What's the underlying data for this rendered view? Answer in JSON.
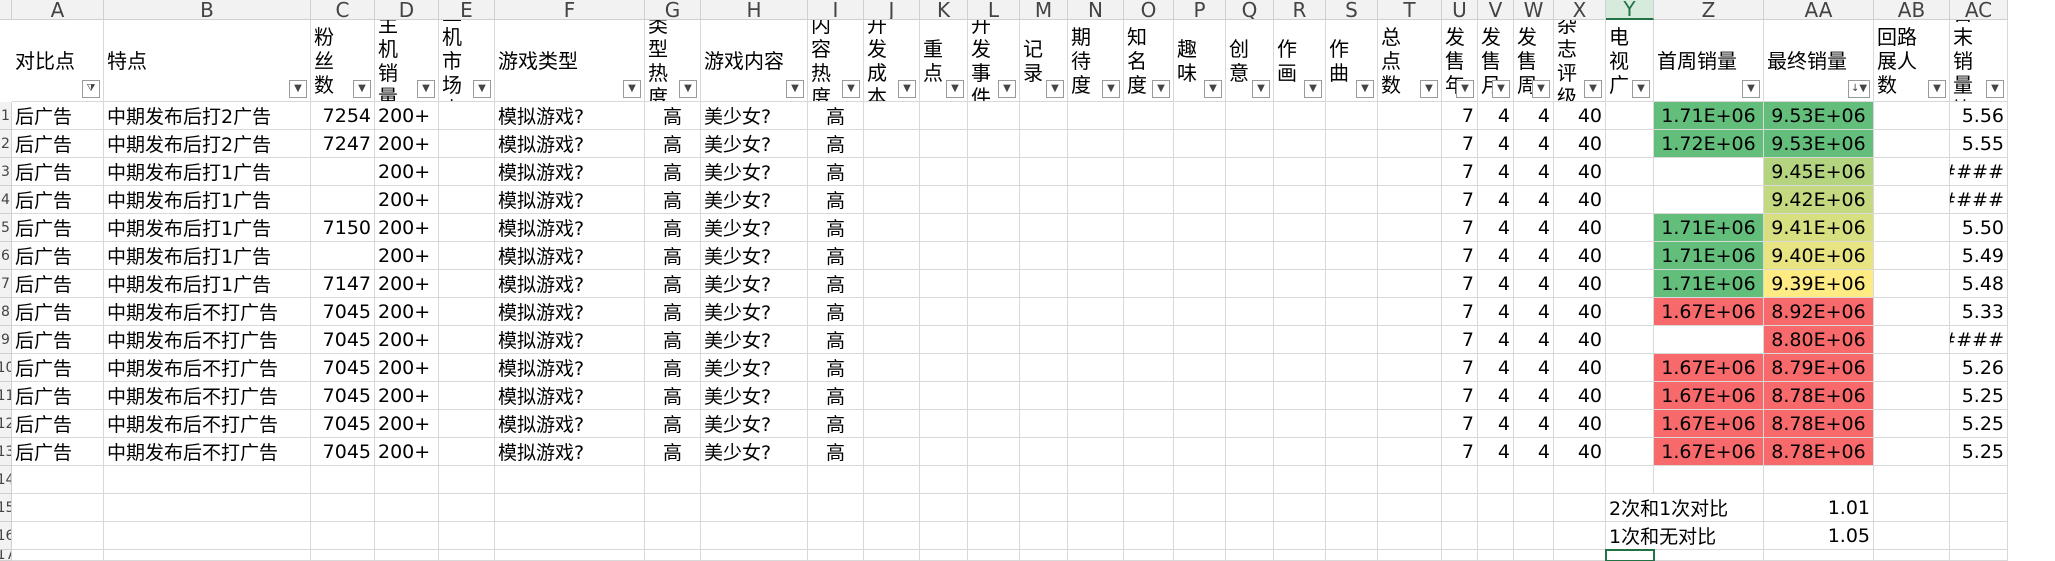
{
  "columns": [
    "A",
    "B",
    "C",
    "D",
    "E",
    "F",
    "G",
    "H",
    "I",
    "J",
    "K",
    "L",
    "M",
    "N",
    "O",
    "P",
    "Q",
    "R",
    "S",
    "T",
    "U",
    "V",
    "W",
    "X",
    "Y",
    "Z",
    "AA",
    "AB",
    "AC"
  ],
  "selected_column": "Y",
  "headers": [
    "对比点",
    "特点",
    "粉丝数",
    "主机销量",
    "主机市场占",
    "游戏类型",
    "类型热度",
    "游戏内容",
    "内容热度",
    "开发成本",
    "重点",
    "开发事件",
    "记录",
    "期待度",
    "知名度",
    "趣味",
    "创意",
    "作画",
    "作曲",
    "总点数",
    "发售年",
    "发售月",
    "发售周",
    "杂志评级",
    "电视广",
    "首周销量",
    "最终销量",
    "回路展人数",
    "首末销量比"
  ],
  "filtered_columns": [
    "A"
  ],
  "sorted_column": "AA",
  "rows": [
    {
      "num": "1",
      "A": "后广告",
      "B": "中期发布后打2广告",
      "C": "7254",
      "D": "200+",
      "F": "模拟游戏?",
      "G": "高",
      "H": "美少女?",
      "I": "高",
      "U": "7",
      "V": "4",
      "W": "4",
      "X": "40",
      "Z": "1.71E+06",
      "AA": "9.53E+06",
      "AC": "5.56"
    },
    {
      "num": "2",
      "A": "后广告",
      "B": "中期发布后打2广告",
      "C": "7247",
      "D": "200+",
      "F": "模拟游戏?",
      "G": "高",
      "H": "美少女?",
      "I": "高",
      "U": "7",
      "V": "4",
      "W": "4",
      "X": "40",
      "Z": "1.72E+06",
      "AA": "9.53E+06",
      "AC": "5.55"
    },
    {
      "num": "3",
      "A": "后广告",
      "B": "中期发布后打1广告",
      "C": "",
      "D": "200+",
      "F": "模拟游戏?",
      "G": "高",
      "H": "美少女?",
      "I": "高",
      "U": "7",
      "V": "4",
      "W": "4",
      "X": "40",
      "Z": "",
      "AA": "9.45E+06",
      "AC": "####"
    },
    {
      "num": "4",
      "A": "后广告",
      "B": "中期发布后打1广告",
      "C": "",
      "D": "200+",
      "F": "模拟游戏?",
      "G": "高",
      "H": "美少女?",
      "I": "高",
      "U": "7",
      "V": "4",
      "W": "4",
      "X": "40",
      "Z": "",
      "AA": "9.42E+06",
      "AC": "####"
    },
    {
      "num": "5",
      "A": "后广告",
      "B": "中期发布后打1广告",
      "C": "7150",
      "D": "200+",
      "F": "模拟游戏?",
      "G": "高",
      "H": "美少女?",
      "I": "高",
      "U": "7",
      "V": "4",
      "W": "4",
      "X": "40",
      "Z": "1.71E+06",
      "AA": "9.41E+06",
      "AC": "5.50"
    },
    {
      "num": "6",
      "A": "后广告",
      "B": "中期发布后打1广告",
      "C": "",
      "D": "200+",
      "F": "模拟游戏?",
      "G": "高",
      "H": "美少女?",
      "I": "高",
      "U": "7",
      "V": "4",
      "W": "4",
      "X": "40",
      "Z": "1.71E+06",
      "AA": "9.40E+06",
      "AC": "5.49"
    },
    {
      "num": "7",
      "A": "后广告",
      "B": "中期发布后打1广告",
      "C": "7147",
      "D": "200+",
      "F": "模拟游戏?",
      "G": "高",
      "H": "美少女?",
      "I": "高",
      "U": "7",
      "V": "4",
      "W": "4",
      "X": "40",
      "Z": "1.71E+06",
      "AA": "9.39E+06",
      "AC": "5.48"
    },
    {
      "num": "8",
      "A": "后广告",
      "B": "中期发布后不打广告",
      "C": "7045",
      "D": "200+",
      "F": "模拟游戏?",
      "G": "高",
      "H": "美少女?",
      "I": "高",
      "U": "7",
      "V": "4",
      "W": "4",
      "X": "40",
      "Z": "1.67E+06",
      "AA": "8.92E+06",
      "AC": "5.33"
    },
    {
      "num": "9",
      "A": "后广告",
      "B": "中期发布后不打广告",
      "C": "7045",
      "D": "200+",
      "F": "模拟游戏?",
      "G": "高",
      "H": "美少女?",
      "I": "高",
      "U": "7",
      "V": "4",
      "W": "4",
      "X": "40",
      "Z": "",
      "AA": "8.80E+06",
      "AC": "####"
    },
    {
      "num": "10",
      "A": "后广告",
      "B": "中期发布后不打广告",
      "C": "7045",
      "D": "200+",
      "F": "模拟游戏?",
      "G": "高",
      "H": "美少女?",
      "I": "高",
      "U": "7",
      "V": "4",
      "W": "4",
      "X": "40",
      "Z": "1.67E+06",
      "AA": "8.79E+06",
      "AC": "5.26"
    },
    {
      "num": "11",
      "A": "后广告",
      "B": "中期发布后不打广告",
      "C": "7045",
      "D": "200+",
      "F": "模拟游戏?",
      "G": "高",
      "H": "美少女?",
      "I": "高",
      "U": "7",
      "V": "4",
      "W": "4",
      "X": "40",
      "Z": "1.67E+06",
      "AA": "8.78E+06",
      "AC": "5.25"
    },
    {
      "num": "12",
      "A": "后广告",
      "B": "中期发布后不打广告",
      "C": "7045",
      "D": "200+",
      "F": "模拟游戏?",
      "G": "高",
      "H": "美少女?",
      "I": "高",
      "U": "7",
      "V": "4",
      "W": "4",
      "X": "40",
      "Z": "1.67E+06",
      "AA": "8.78E+06",
      "AC": "5.25"
    },
    {
      "num": "13",
      "A": "后广告",
      "B": "中期发布后不打广告",
      "C": "7045",
      "D": "200+",
      "F": "模拟游戏?",
      "G": "高",
      "H": "美少女?",
      "I": "高",
      "U": "7",
      "V": "4",
      "W": "4",
      "X": "40",
      "Z": "1.67E+06",
      "AA": "8.78E+06",
      "AC": "5.25"
    }
  ],
  "cell_fills": {
    "Z": [
      "#63be7b",
      "#63be7b",
      "",
      "",
      "#63be7b",
      "#63be7b",
      "#63be7b",
      "#f8696b",
      "",
      "#f8696b",
      "#f8696b",
      "#f8696b",
      "#f8696b"
    ],
    "AA": [
      "#63be7b",
      "#63be7b",
      "#b4d47f",
      "#c5d980",
      "#d7df81",
      "#e8e482",
      "#ffeb84",
      "#f8696b",
      "#f8696b",
      "#f8696b",
      "#f8696b",
      "#f8696b",
      "#f8696b"
    ]
  },
  "indicator_rows": [
    "3",
    "4",
    "9"
  ],
  "empty_rows": [
    "14"
  ],
  "summary_rows": [
    {
      "num": "15",
      "label": "2次和1次对比",
      "value": "1.01"
    },
    {
      "num": "16",
      "label": "1次和无对比",
      "value": "1.05"
    }
  ],
  "partial_row": "17",
  "colors": {
    "accent": "#217346",
    "green": "#63be7b",
    "red": "#f8696b",
    "yellow": "#ffeb84"
  }
}
